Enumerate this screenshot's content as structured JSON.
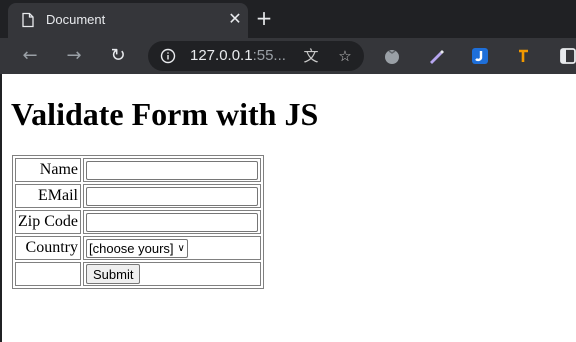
{
  "browser": {
    "tab_title": "Document",
    "tab_close": "✕",
    "new_tab": "+",
    "nav": {
      "back": "←",
      "forward": "→",
      "reload": "↻"
    },
    "url_host": "127.0.0.1",
    "url_rest": ":55...",
    "translate_icon": "文",
    "bookmark_icon": "☆"
  },
  "page": {
    "heading": "Validate Form with JS",
    "form": {
      "name_label": "Name",
      "email_label": "EMail",
      "zip_label": "Zip Code",
      "country_label": "Country",
      "country_selected": "[choose yours]",
      "submit_label": "Submit"
    }
  }
}
